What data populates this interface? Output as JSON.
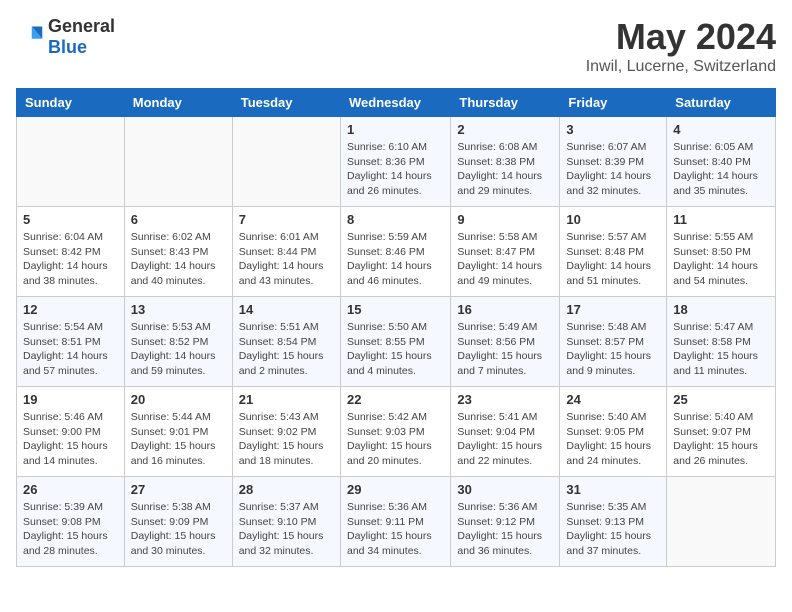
{
  "header": {
    "logo_general": "General",
    "logo_blue": "Blue",
    "title": "May 2024",
    "location": "Inwil, Lucerne, Switzerland"
  },
  "days_of_week": [
    "Sunday",
    "Monday",
    "Tuesday",
    "Wednesday",
    "Thursday",
    "Friday",
    "Saturday"
  ],
  "weeks": [
    [
      {
        "day": "",
        "info": ""
      },
      {
        "day": "",
        "info": ""
      },
      {
        "day": "",
        "info": ""
      },
      {
        "day": "1",
        "info": "Sunrise: 6:10 AM\nSunset: 8:36 PM\nDaylight: 14 hours and 26 minutes."
      },
      {
        "day": "2",
        "info": "Sunrise: 6:08 AM\nSunset: 8:38 PM\nDaylight: 14 hours and 29 minutes."
      },
      {
        "day": "3",
        "info": "Sunrise: 6:07 AM\nSunset: 8:39 PM\nDaylight: 14 hours and 32 minutes."
      },
      {
        "day": "4",
        "info": "Sunrise: 6:05 AM\nSunset: 8:40 PM\nDaylight: 14 hours and 35 minutes."
      }
    ],
    [
      {
        "day": "5",
        "info": "Sunrise: 6:04 AM\nSunset: 8:42 PM\nDaylight: 14 hours and 38 minutes."
      },
      {
        "day": "6",
        "info": "Sunrise: 6:02 AM\nSunset: 8:43 PM\nDaylight: 14 hours and 40 minutes."
      },
      {
        "day": "7",
        "info": "Sunrise: 6:01 AM\nSunset: 8:44 PM\nDaylight: 14 hours and 43 minutes."
      },
      {
        "day": "8",
        "info": "Sunrise: 5:59 AM\nSunset: 8:46 PM\nDaylight: 14 hours and 46 minutes."
      },
      {
        "day": "9",
        "info": "Sunrise: 5:58 AM\nSunset: 8:47 PM\nDaylight: 14 hours and 49 minutes."
      },
      {
        "day": "10",
        "info": "Sunrise: 5:57 AM\nSunset: 8:48 PM\nDaylight: 14 hours and 51 minutes."
      },
      {
        "day": "11",
        "info": "Sunrise: 5:55 AM\nSunset: 8:50 PM\nDaylight: 14 hours and 54 minutes."
      }
    ],
    [
      {
        "day": "12",
        "info": "Sunrise: 5:54 AM\nSunset: 8:51 PM\nDaylight: 14 hours and 57 minutes."
      },
      {
        "day": "13",
        "info": "Sunrise: 5:53 AM\nSunset: 8:52 PM\nDaylight: 14 hours and 59 minutes."
      },
      {
        "day": "14",
        "info": "Sunrise: 5:51 AM\nSunset: 8:54 PM\nDaylight: 15 hours and 2 minutes."
      },
      {
        "day": "15",
        "info": "Sunrise: 5:50 AM\nSunset: 8:55 PM\nDaylight: 15 hours and 4 minutes."
      },
      {
        "day": "16",
        "info": "Sunrise: 5:49 AM\nSunset: 8:56 PM\nDaylight: 15 hours and 7 minutes."
      },
      {
        "day": "17",
        "info": "Sunrise: 5:48 AM\nSunset: 8:57 PM\nDaylight: 15 hours and 9 minutes."
      },
      {
        "day": "18",
        "info": "Sunrise: 5:47 AM\nSunset: 8:58 PM\nDaylight: 15 hours and 11 minutes."
      }
    ],
    [
      {
        "day": "19",
        "info": "Sunrise: 5:46 AM\nSunset: 9:00 PM\nDaylight: 15 hours and 14 minutes."
      },
      {
        "day": "20",
        "info": "Sunrise: 5:44 AM\nSunset: 9:01 PM\nDaylight: 15 hours and 16 minutes."
      },
      {
        "day": "21",
        "info": "Sunrise: 5:43 AM\nSunset: 9:02 PM\nDaylight: 15 hours and 18 minutes."
      },
      {
        "day": "22",
        "info": "Sunrise: 5:42 AM\nSunset: 9:03 PM\nDaylight: 15 hours and 20 minutes."
      },
      {
        "day": "23",
        "info": "Sunrise: 5:41 AM\nSunset: 9:04 PM\nDaylight: 15 hours and 22 minutes."
      },
      {
        "day": "24",
        "info": "Sunrise: 5:40 AM\nSunset: 9:05 PM\nDaylight: 15 hours and 24 minutes."
      },
      {
        "day": "25",
        "info": "Sunrise: 5:40 AM\nSunset: 9:07 PM\nDaylight: 15 hours and 26 minutes."
      }
    ],
    [
      {
        "day": "26",
        "info": "Sunrise: 5:39 AM\nSunset: 9:08 PM\nDaylight: 15 hours and 28 minutes."
      },
      {
        "day": "27",
        "info": "Sunrise: 5:38 AM\nSunset: 9:09 PM\nDaylight: 15 hours and 30 minutes."
      },
      {
        "day": "28",
        "info": "Sunrise: 5:37 AM\nSunset: 9:10 PM\nDaylight: 15 hours and 32 minutes."
      },
      {
        "day": "29",
        "info": "Sunrise: 5:36 AM\nSunset: 9:11 PM\nDaylight: 15 hours and 34 minutes."
      },
      {
        "day": "30",
        "info": "Sunrise: 5:36 AM\nSunset: 9:12 PM\nDaylight: 15 hours and 36 minutes."
      },
      {
        "day": "31",
        "info": "Sunrise: 5:35 AM\nSunset: 9:13 PM\nDaylight: 15 hours and 37 minutes."
      },
      {
        "day": "",
        "info": ""
      }
    ]
  ],
  "accent_color": "#1a6bbf"
}
